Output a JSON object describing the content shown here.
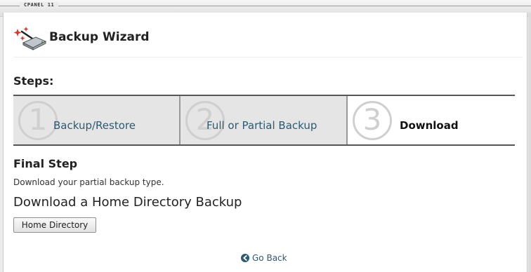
{
  "brand": "CPANEL 11",
  "header": {
    "title": "Backup Wizard",
    "icon": "backup-wizard-icon"
  },
  "steps": {
    "title": "Steps:",
    "items": [
      {
        "number": "1",
        "label": "Backup/Restore",
        "state": "inactive"
      },
      {
        "number": "2",
        "label": "Full or Partial Backup",
        "state": "inactive"
      },
      {
        "number": "3",
        "label": "Download",
        "state": "active"
      }
    ]
  },
  "final": {
    "title": "Final Step",
    "description": "Download your partial backup type.",
    "section_title": "Download a Home Directory Backup",
    "button_label": "Home Directory"
  },
  "footer": {
    "go_back_label": "Go Back",
    "go_back_icon": "back-arrow-circle-icon"
  },
  "colors": {
    "link": "#2b5a73",
    "inactive_step_bg": "#e5e5e5",
    "step_number": "#cfcfcf"
  }
}
